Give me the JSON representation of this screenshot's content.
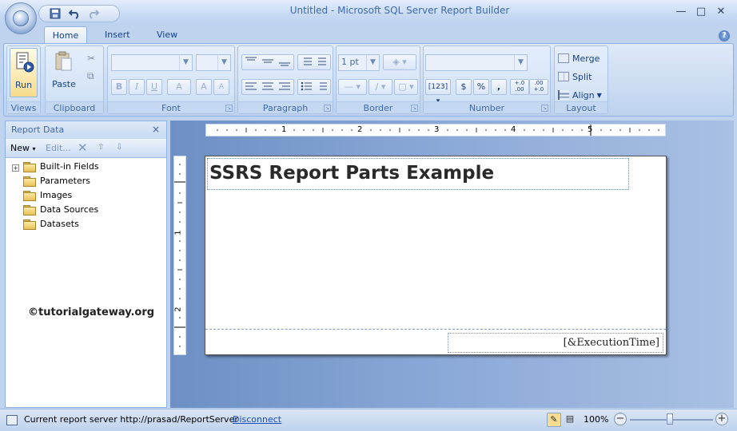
{
  "window": {
    "title": "Untitled - Microsoft SQL Server Report Builder",
    "controls": {
      "minimize": "—",
      "maximize": "□",
      "close": "✕"
    }
  },
  "tabs": [
    {
      "label": "Home"
    },
    {
      "label": "Insert"
    },
    {
      "label": "View"
    }
  ],
  "help_label": "?",
  "ribbon": {
    "groups": {
      "views": {
        "label": "Views",
        "run_label": "Run"
      },
      "clipboard": {
        "label": "Clipboard",
        "paste_label": "Paste"
      },
      "font": {
        "label": "Font",
        "bold": "B",
        "italic": "I",
        "underline": "U",
        "color": "A",
        "grow": "A",
        "shrink": "A"
      },
      "paragraph": {
        "label": "Paragraph"
      },
      "border": {
        "label": "Border",
        "width_value": "1 pt"
      },
      "number": {
        "label": "Number",
        "currency": "$",
        "percent": "%",
        "comma": ",",
        "inc_decimal": "+.0 .00",
        "dec_decimal": ".00 +.0"
      },
      "layout": {
        "label": "Layout",
        "merge_label": "Merge",
        "split_label": "Split",
        "align_label": "Align"
      }
    }
  },
  "report_data": {
    "header": "Report Data",
    "close_label": "×",
    "toolbar": {
      "new_label": "New",
      "edit_label": "Edit...",
      "expand_label": "+"
    },
    "items": [
      {
        "label": "Built-in Fields"
      },
      {
        "label": "Parameters"
      },
      {
        "label": "Images"
      },
      {
        "label": "Data Sources"
      },
      {
        "label": "Datasets"
      }
    ]
  },
  "watermark": "©tutorialgateway.org",
  "ruler": {
    "top_marks": [
      "1",
      "2",
      "3",
      "4",
      "5"
    ],
    "left_marks": [
      "1",
      "2"
    ]
  },
  "report": {
    "title": "SSRS Report Parts Example",
    "footer_expression": "[&ExecutionTime]"
  },
  "status": {
    "server_text": "Current report server http://prasad/ReportServer",
    "disconnect_label": "Disconnect",
    "zoom": "100%",
    "zoom_out": "−",
    "zoom_in": "+"
  },
  "colors": {
    "ribbon_text": "#15428b",
    "canvas_bg": "#ffffff",
    "design_bg": "#7f9fd0"
  }
}
